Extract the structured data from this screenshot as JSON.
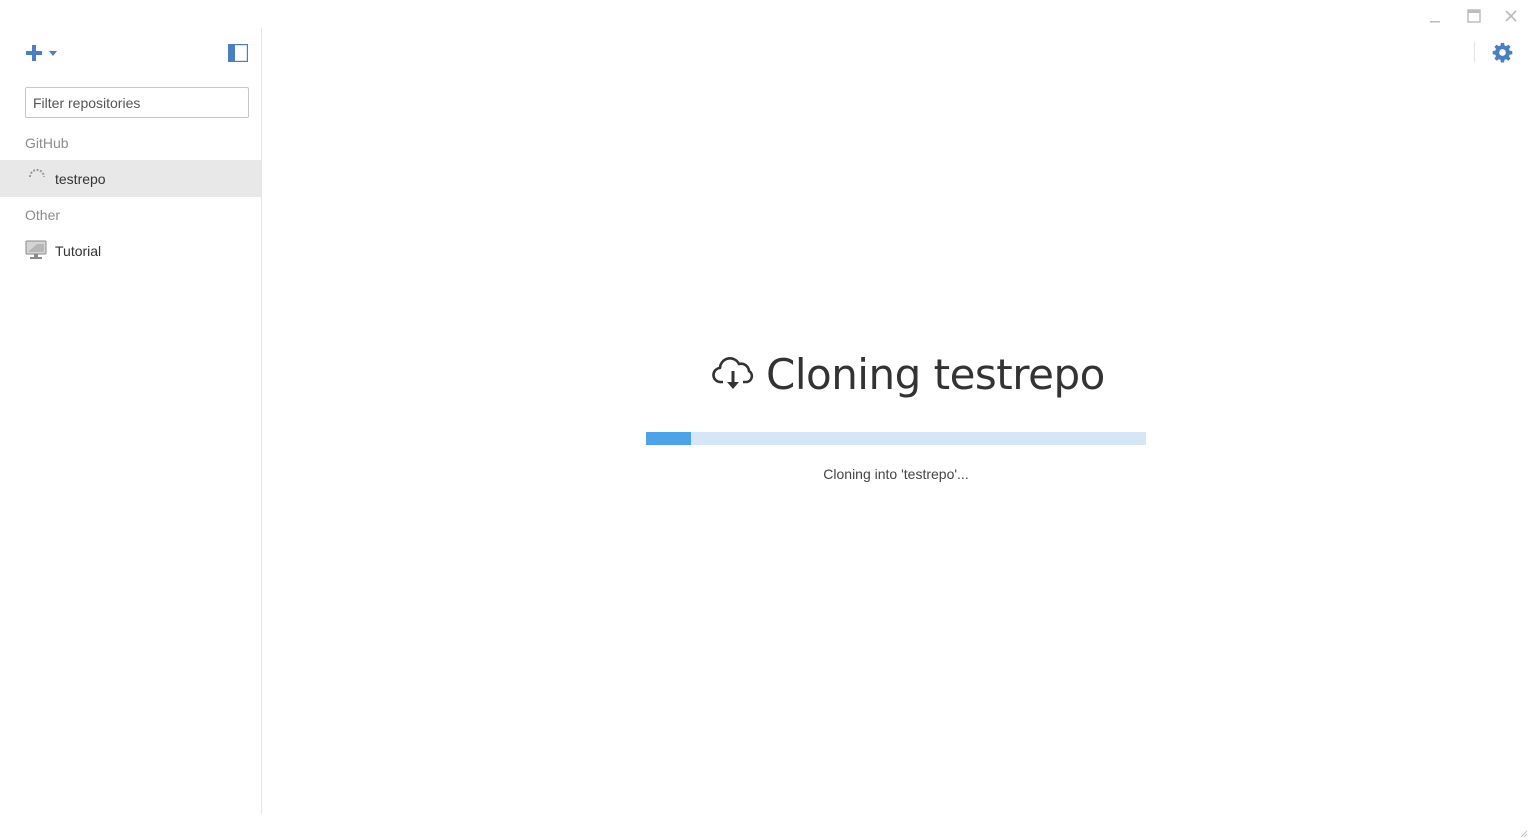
{
  "sidebar": {
    "filter": {
      "placeholder": "Filter repositories",
      "value": ""
    },
    "groups": [
      {
        "title": "GitHub",
        "items": [
          {
            "label": "testrepo",
            "icon": "loading-spinner-icon",
            "selected": true
          }
        ]
      },
      {
        "title": "Other",
        "items": [
          {
            "label": "Tutorial",
            "icon": "monitor-icon",
            "selected": false
          }
        ]
      }
    ]
  },
  "main": {
    "title": "Cloning testrepo",
    "status": "Cloning into 'testrepo'...",
    "progress": 0.09
  },
  "colors": {
    "accent": "#4a7fc1",
    "progress_fill": "#4ea3e6",
    "progress_track": "#d7e6f5",
    "selected_row": "#e8e8e8"
  }
}
